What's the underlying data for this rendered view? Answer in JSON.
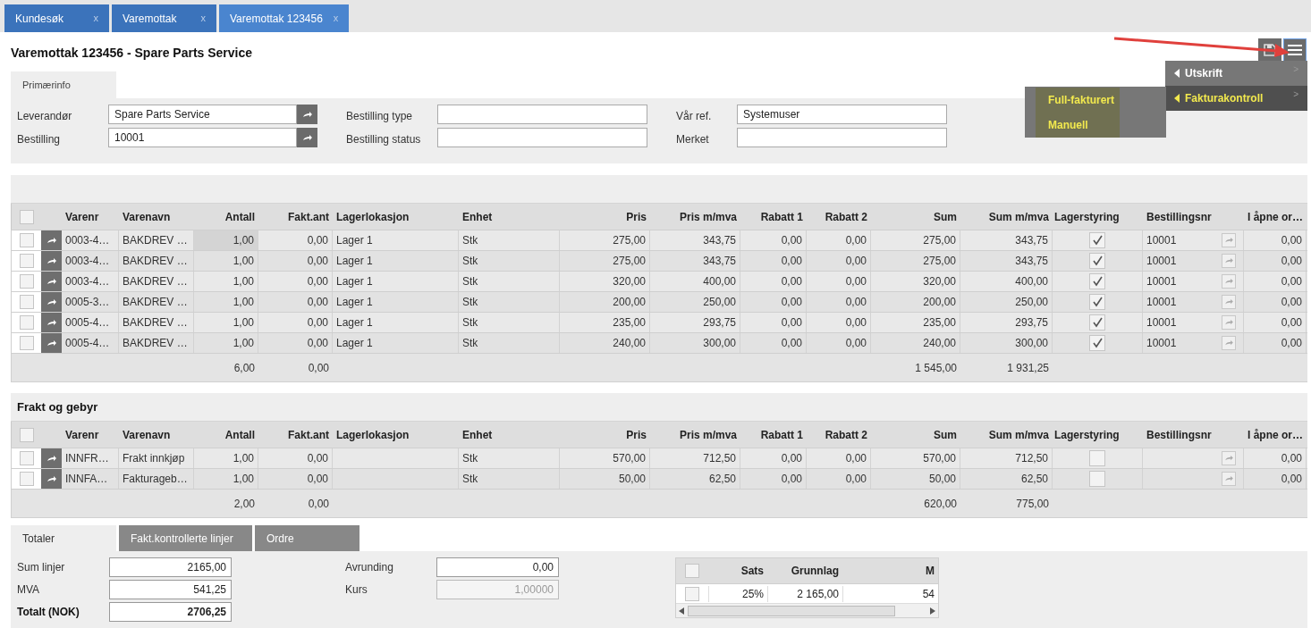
{
  "tabs": [
    {
      "label": "Kundesøk",
      "close": "x",
      "selected": false
    },
    {
      "label": "Varemottak",
      "close": "x",
      "selected": false
    },
    {
      "label": "Varemottak 123456",
      "close": "x",
      "selected": true
    }
  ],
  "title": "Varemottak 123456 - Spare Parts Service",
  "menu": {
    "items": [
      {
        "label": "Utskrift",
        "more": ">",
        "active": false
      },
      {
        "label": "Fakturakontroll",
        "more": ">",
        "active": true
      }
    ],
    "submenu": [
      "Full-fakturert",
      "Manuell"
    ]
  },
  "form_tab": {
    "label": "Primærinfo",
    "selected": true
  },
  "form": [
    [
      {
        "label": "Leverandør",
        "value": "Spare Parts Service",
        "kind": "lookup"
      },
      {
        "label": "Bestilling",
        "value": "10001",
        "kind": "lookup"
      }
    ],
    [
      {
        "label": "Bestilling type",
        "kind": "text"
      },
      {
        "label": "Bestilling status",
        "kind": "text"
      }
    ],
    [
      {
        "label": "Vår ref.",
        "value": "Systemuser",
        "kind": "text"
      },
      {
        "label": "Merket",
        "kind": "text"
      }
    ]
  ],
  "lines": {
    "all_checked": false,
    "columns": [
      {
        "label": "Varenr",
        "kind": "text"
      },
      {
        "label": "Varenavn",
        "kind": "text"
      },
      {
        "label": "Antall",
        "kind": "number",
        "total": "6,00"
      },
      {
        "label": "Fakt.ant",
        "kind": "number",
        "total": "0,00"
      },
      {
        "label": "Lagerlokasjon",
        "kind": "text"
      },
      {
        "label": "Enhet",
        "kind": "text"
      },
      {
        "label": "Pris",
        "kind": "number"
      },
      {
        "label": "Pris m/mva",
        "kind": "number"
      },
      {
        "label": "Rabatt 1",
        "kind": "number"
      },
      {
        "label": "Rabatt 2",
        "kind": "number"
      },
      {
        "label": "Sum",
        "kind": "number",
        "total": "1 545,00"
      },
      {
        "label": "Sum m/mva",
        "kind": "number",
        "total": "1 931,25"
      },
      {
        "label": "Lagerstyring",
        "kind": "check"
      },
      {
        "label": "Bestillingsnr",
        "kind": "link"
      },
      {
        "label": "I åpne or…",
        "kind": "number"
      }
    ],
    "rows": [
      {
        "checked": false,
        "cells": [
          "0003-4…",
          "BAKDREV …",
          "1,00",
          "0,00",
          "Lager 1",
          "Stk",
          "275,00",
          "343,75",
          "0,00",
          "0,00",
          "275,00",
          "343,75",
          true,
          "10001",
          "0,00"
        ]
      },
      {
        "checked": false,
        "cells": [
          "0003-4…",
          "BAKDREV …",
          "1,00",
          "0,00",
          "Lager 1",
          "Stk",
          "275,00",
          "343,75",
          "0,00",
          "0,00",
          "275,00",
          "343,75",
          true,
          "10001",
          "0,00"
        ]
      },
      {
        "checked": false,
        "cells": [
          "0003-4…",
          "BAKDREV …",
          "1,00",
          "0,00",
          "Lager 1",
          "Stk",
          "320,00",
          "400,00",
          "0,00",
          "0,00",
          "320,00",
          "400,00",
          true,
          "10001",
          "0,00"
        ]
      },
      {
        "checked": false,
        "cells": [
          "0005-3…",
          "BAKDREV …",
          "1,00",
          "0,00",
          "Lager 1",
          "Stk",
          "200,00",
          "250,00",
          "0,00",
          "0,00",
          "200,00",
          "250,00",
          true,
          "10001",
          "0,00"
        ]
      },
      {
        "checked": false,
        "cells": [
          "0005-4…",
          "BAKDREV …",
          "1,00",
          "0,00",
          "Lager 1",
          "Stk",
          "235,00",
          "293,75",
          "0,00",
          "0,00",
          "235,00",
          "293,75",
          true,
          "10001",
          "0,00"
        ]
      },
      {
        "checked": false,
        "cells": [
          "0005-4…",
          "BAKDREV …",
          "1,00",
          "0,00",
          "Lager 1",
          "Stk",
          "240,00",
          "300,00",
          "0,00",
          "0,00",
          "240,00",
          "300,00",
          true,
          "10001",
          "0,00"
        ]
      }
    ]
  },
  "fees": {
    "title": "Frakt og gebyr",
    "all_checked": false,
    "columns": [
      {
        "label": "Varenr",
        "kind": "text"
      },
      {
        "label": "Varenavn",
        "kind": "text"
      },
      {
        "label": "Antall",
        "kind": "number",
        "total": "2,00"
      },
      {
        "label": "Fakt.ant",
        "kind": "number",
        "total": "0,00"
      },
      {
        "label": "Lagerlokasjon",
        "kind": "text"
      },
      {
        "label": "Enhet",
        "kind": "text"
      },
      {
        "label": "Pris",
        "kind": "number"
      },
      {
        "label": "Pris m/mva",
        "kind": "number"
      },
      {
        "label": "Rabatt 1",
        "kind": "number"
      },
      {
        "label": "Rabatt 2",
        "kind": "number"
      },
      {
        "label": "Sum",
        "kind": "number",
        "total": "620,00"
      },
      {
        "label": "Sum m/mva",
        "kind": "number",
        "total": "775,00"
      },
      {
        "label": "Lagerstyring",
        "kind": "check"
      },
      {
        "label": "Bestillingsnr",
        "kind": "link"
      },
      {
        "label": "I åpne or…",
        "kind": "number"
      }
    ],
    "rows": [
      {
        "checked": false,
        "cells": [
          "INNFR…",
          "Frakt innkjøp",
          "1,00",
          "0,00",
          null,
          "Stk",
          "570,00",
          "712,50",
          "0,00",
          "0,00",
          "570,00",
          "712,50",
          false,
          null,
          "0,00"
        ]
      },
      {
        "checked": false,
        "cells": [
          "INNFA…",
          "Fakturageb…",
          "1,00",
          "0,00",
          null,
          "Stk",
          "50,00",
          "62,50",
          "0,00",
          "0,00",
          "50,00",
          "62,50",
          false,
          null,
          "0,00"
        ]
      }
    ]
  },
  "bottom_tabs": [
    {
      "label": "Totaler",
      "selected": true
    },
    {
      "label": "Fakt.kontrollerte linjer",
      "selected": false
    },
    {
      "label": "Ordre",
      "selected": false
    }
  ],
  "totals_fields": [
    [
      {
        "label": "Sum linjer",
        "value": "2165,00",
        "bold": false,
        "disabled": false
      },
      {
        "label": "MVA",
        "value": "541,25",
        "bold": false,
        "disabled": false
      },
      {
        "label": "Totalt (NOK)",
        "value": "2706,25",
        "bold": true,
        "disabled": false
      }
    ],
    [
      {
        "label": "Avrunding",
        "value": "0,00",
        "bold": false,
        "disabled": false
      },
      {
        "label": "Kurs",
        "value": "1,00000",
        "bold": false,
        "disabled": true
      }
    ]
  ],
  "vat_table": {
    "all_checked": false,
    "columns": [
      "Sats",
      "Grunnlag",
      "M"
    ],
    "rows": [
      {
        "checked": false,
        "cells": [
          "25%",
          "2 165,00",
          "54"
        ]
      }
    ]
  }
}
